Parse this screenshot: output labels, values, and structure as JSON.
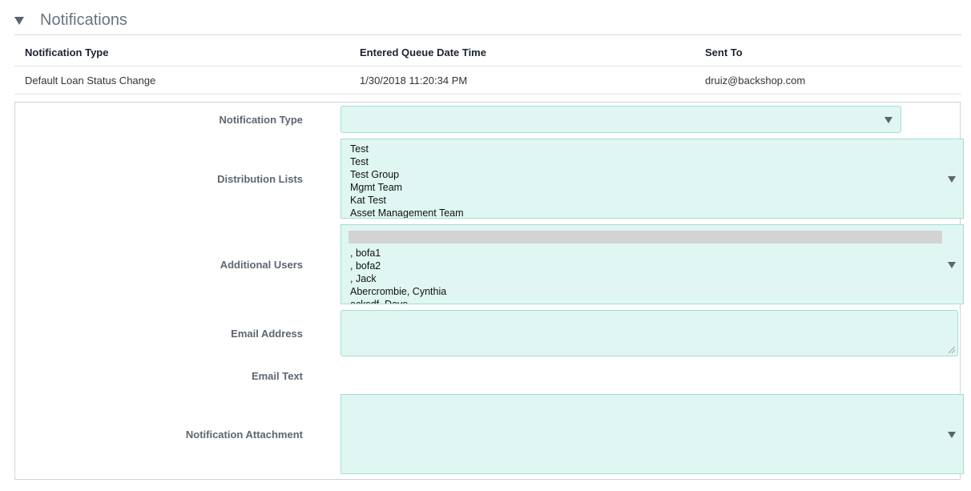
{
  "section": {
    "title": "Notifications"
  },
  "table": {
    "headers": [
      "Notification Type",
      "Entered Queue Date Time",
      "Sent To"
    ],
    "rows": [
      [
        "Default Loan Status Change",
        "1/30/2018 11:20:34 PM",
        "druiz@backshop.com"
      ]
    ]
  },
  "form": {
    "notification_type": {
      "label": "Notification Type",
      "value": ""
    },
    "distribution_lists": {
      "label": "Distribution Lists",
      "options": [
        "Test",
        "Test",
        "Test Group",
        "Mgmt Team",
        "Kat Test",
        "Asset Management Team"
      ]
    },
    "additional_users": {
      "label": "Additional Users",
      "options": [
        ", bofa1",
        ", bofa2",
        ", Jack",
        "Abercrombie, Cynthia",
        "acksdf, Dave"
      ]
    },
    "email_address": {
      "label": "Email Address",
      "value": ""
    },
    "email_text": {
      "label": "Email Text"
    },
    "notification_attachment": {
      "label": "Notification Attachment"
    }
  }
}
